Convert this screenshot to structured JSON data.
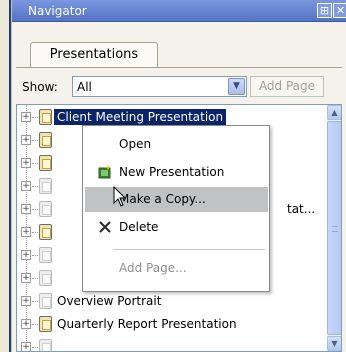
{
  "window": {
    "title": "Navigator",
    "pin_glyph": "⊞",
    "close_glyph": "✕"
  },
  "tabs": [
    {
      "label": "Presentations",
      "active": true
    }
  ],
  "toolbar": {
    "show_label": "Show:",
    "show_value": "All",
    "add_page_label": "Add Page",
    "add_page_enabled": false
  },
  "tree": {
    "items": [
      {
        "label": "Client Meeting Presentation",
        "selected": true
      },
      {
        "label": ""
      },
      {
        "label": ""
      },
      {
        "label": ""
      },
      {
        "label": "",
        "tail": "tat..."
      },
      {
        "label": ""
      },
      {
        "label": ""
      },
      {
        "label": ""
      },
      {
        "label": "Overview Portrait"
      },
      {
        "label": "Quarterly Report Presentation"
      }
    ]
  },
  "context_menu": {
    "items": [
      {
        "label": "Open",
        "icon": "none"
      },
      {
        "label": "New Presentation",
        "icon": "new-presentation-icon"
      },
      {
        "label": "Make a Copy...",
        "icon": "none",
        "highlighted": true
      },
      {
        "label": "Delete",
        "icon": "delete-x-icon"
      },
      {
        "label": "Add Page...",
        "icon": "none",
        "disabled": true
      }
    ]
  },
  "colors": {
    "selection": "#0a246a",
    "menu_highlight": "#c1c2c4",
    "titlebar": "#6a87d3"
  }
}
